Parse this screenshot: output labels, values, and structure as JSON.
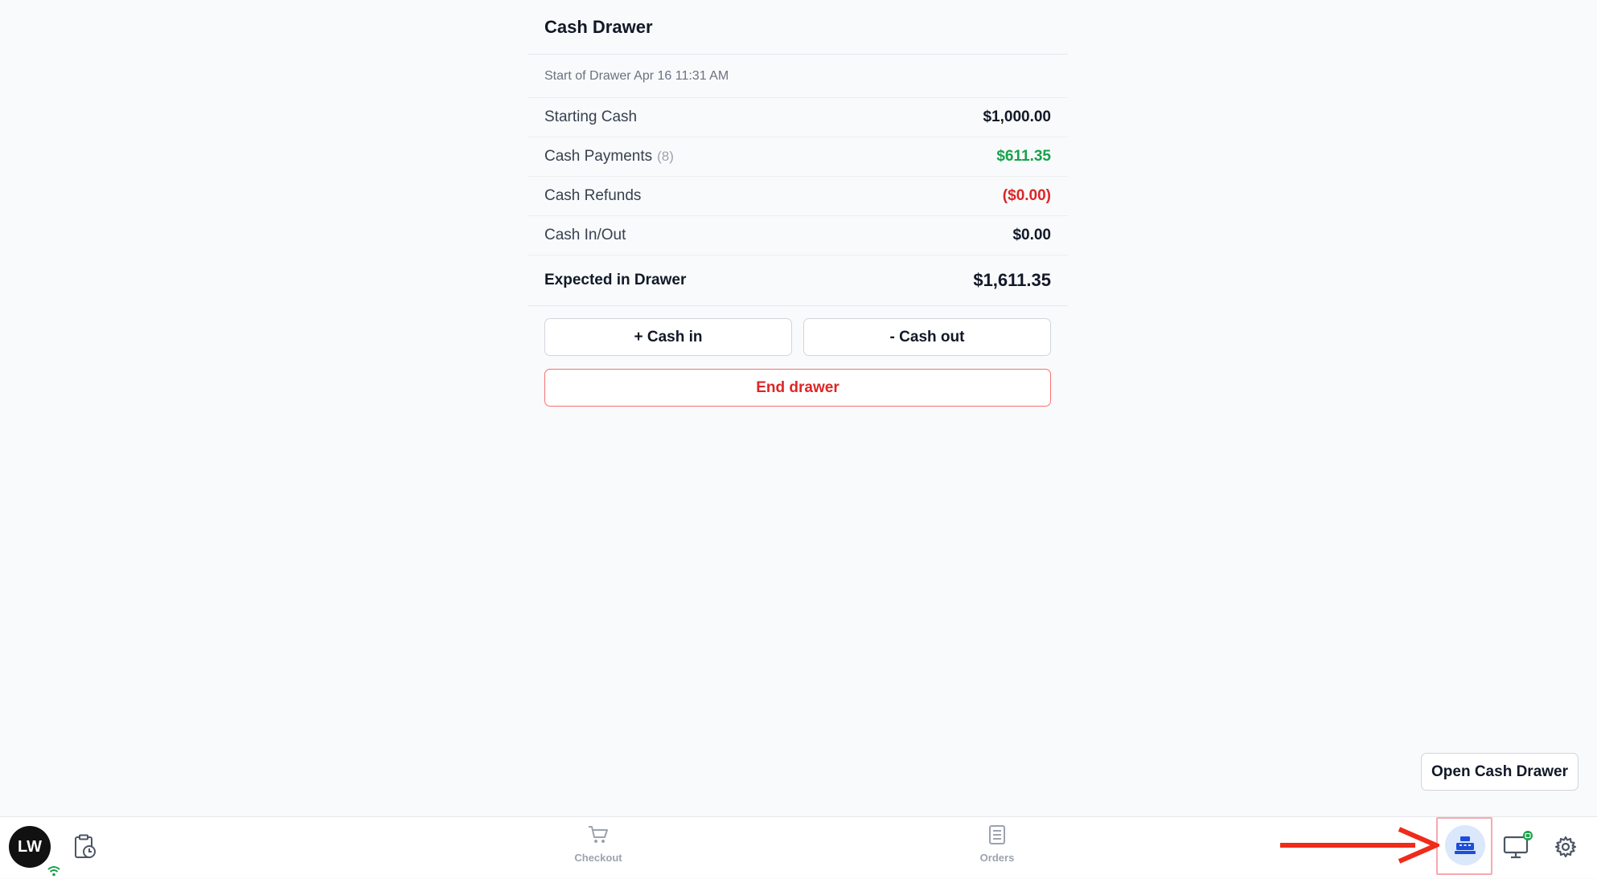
{
  "panel": {
    "title": "Cash Drawer",
    "start_line": "Start of Drawer Apr 16 11:31 AM",
    "rows": [
      {
        "label": "Starting Cash",
        "count": "",
        "value": "$1,000.00"
      },
      {
        "label": "Cash Payments",
        "count": "(8)",
        "value": "$611.35"
      },
      {
        "label": "Cash Refunds",
        "count": "",
        "value": "($0.00)"
      },
      {
        "label": "Cash In/Out",
        "count": "",
        "value": "$0.00"
      }
    ],
    "total": {
      "label": "Expected in Drawer",
      "value": "$1,611.35"
    },
    "cash_in_label": "+ Cash in",
    "cash_out_label": "- Cash out",
    "end_drawer_label": "End drawer"
  },
  "open_drawer_label": "Open Cash Drawer",
  "bottombar": {
    "avatar_initials": "LW",
    "nav": [
      {
        "label": "Checkout",
        "icon": "cart-icon"
      },
      {
        "label": "Orders",
        "icon": "orders-icon"
      }
    ],
    "right_icons": [
      "cash-register-icon",
      "display-icon",
      "gear-icon"
    ]
  },
  "colors": {
    "positive": "#16a34a",
    "negative": "#dc2626",
    "annotation_arrow": "#ef2b1a",
    "active_icon_bg": "#dbe7fb"
  }
}
